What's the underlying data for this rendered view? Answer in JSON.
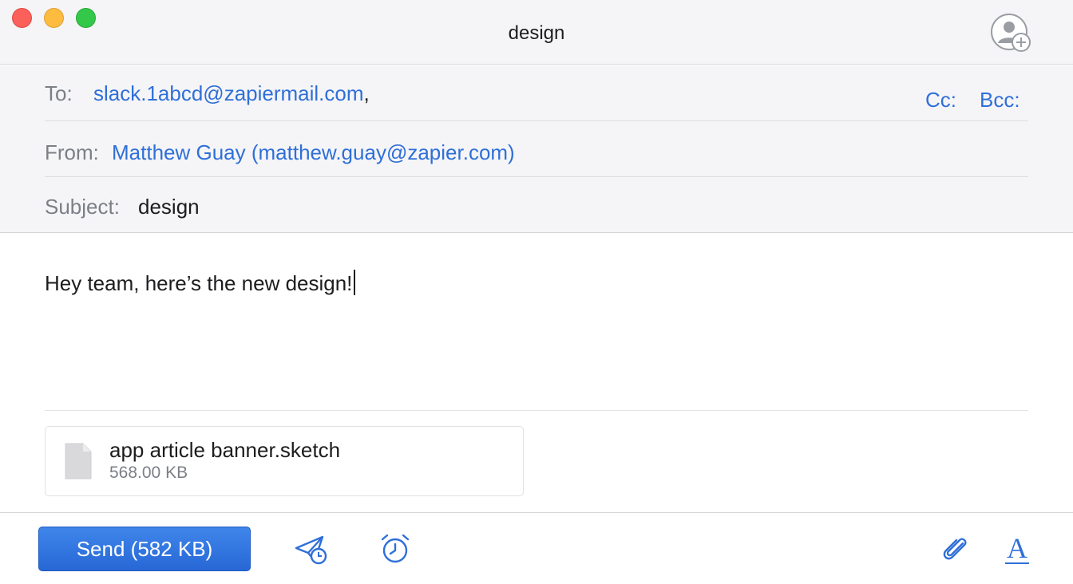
{
  "window": {
    "title": "design"
  },
  "headers": {
    "to": {
      "label": "To:",
      "value": "slack.1abcd@zapiermail.com",
      "separator": ","
    },
    "cc_label": "Cc:",
    "bcc_label": "Bcc:",
    "from": {
      "label": "From:",
      "value": "Matthew Guay (matthew.guay@zapier.com)"
    },
    "subject": {
      "label": "Subject:",
      "value": "design"
    }
  },
  "body": {
    "text": "Hey team, here’s the new design!"
  },
  "attachment": {
    "name": "app article banner.sketch",
    "size": "568.00 KB",
    "icon": "document-icon"
  },
  "toolbar": {
    "send_label": "Send (582 KB)",
    "icons": [
      "send-later-icon",
      "reminder-alarm-icon",
      "paperclip-icon",
      "format-text-icon"
    ],
    "format_glyph": "A"
  },
  "colors": {
    "accent": "#2f6fd8",
    "send_button": "#2f73de",
    "header_bg": "#f5f5f7",
    "label": "#7b7f86",
    "traffic_close": "#fc605b",
    "traffic_minimize": "#fdbc40",
    "traffic_zoom": "#34c84a"
  }
}
